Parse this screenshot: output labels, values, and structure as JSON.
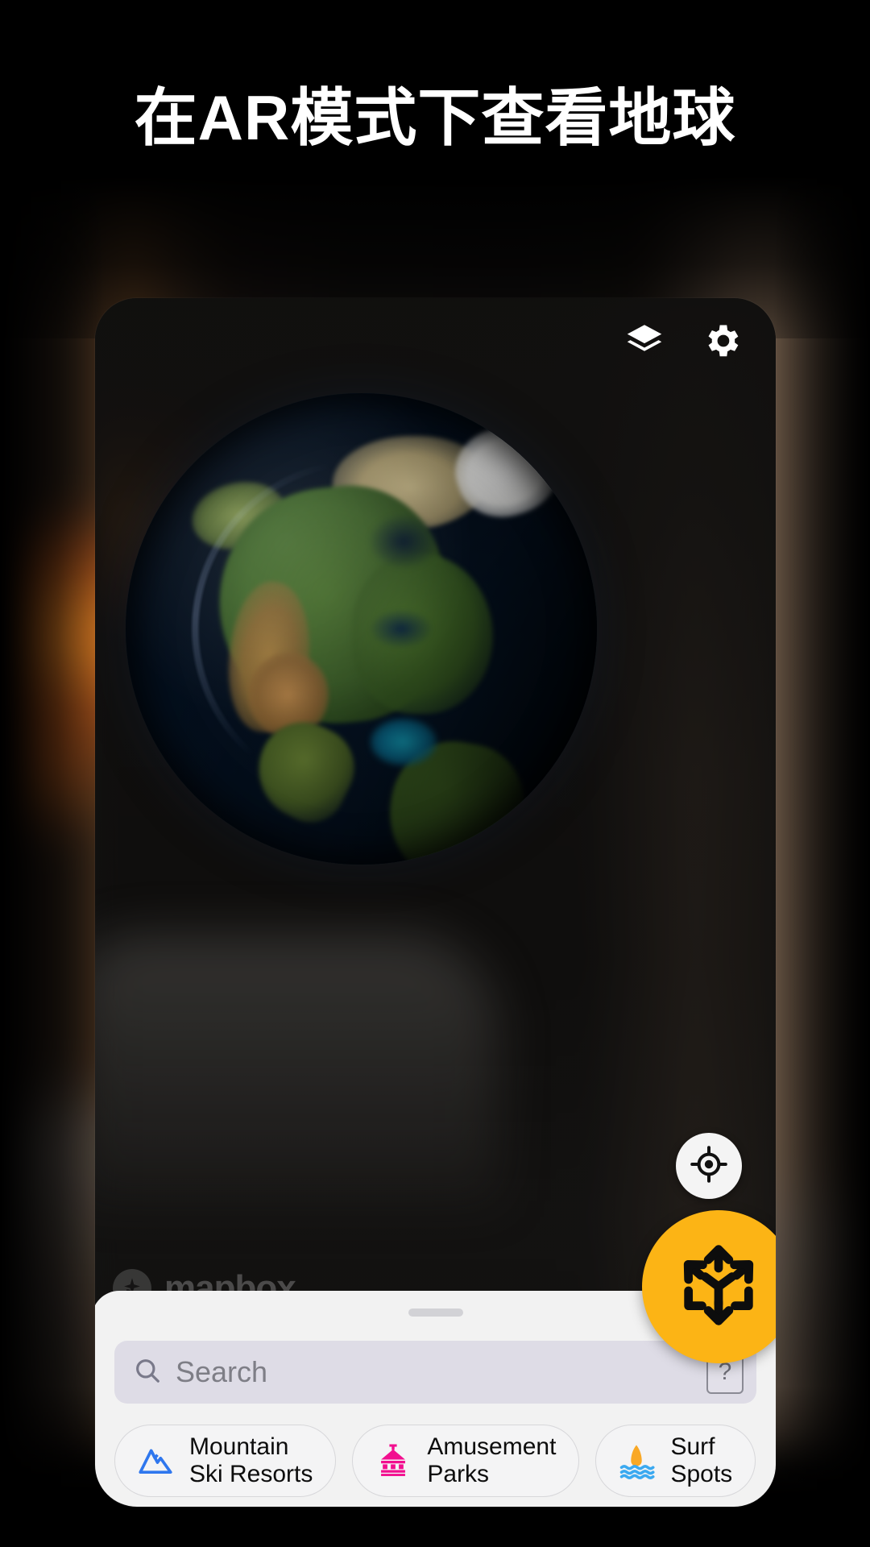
{
  "headline": "在AR模式下查看地球",
  "map": {
    "top_controls": [
      {
        "name": "layers-icon",
        "label": "Layers"
      },
      {
        "name": "gear-icon",
        "label": "Settings"
      }
    ],
    "attribution": "mapbox",
    "locate_label": "Locate me",
    "ar_label": "AR mode"
  },
  "sheet": {
    "handle_label": "Drag handle",
    "search": {
      "placeholder": "Search",
      "value": "",
      "icon": "search-icon",
      "help_badge": "?"
    },
    "chips": [
      {
        "label": "Mountain\nSki Resorts",
        "icon": "mountain-icon",
        "color": "#2f77ee"
      },
      {
        "label": "Amusement\nParks",
        "icon": "carousel-icon",
        "color": "#f20f8f"
      },
      {
        "label": "Surf\nSpots",
        "icon": "surf-icon",
        "color": "#f9a825"
      }
    ]
  },
  "colors": {
    "accent": "#fcb415",
    "sheet_bg": "#f2f2f2",
    "search_bg": "#dedce6",
    "headline": "#ffffff",
    "page_bg": "#000000"
  }
}
